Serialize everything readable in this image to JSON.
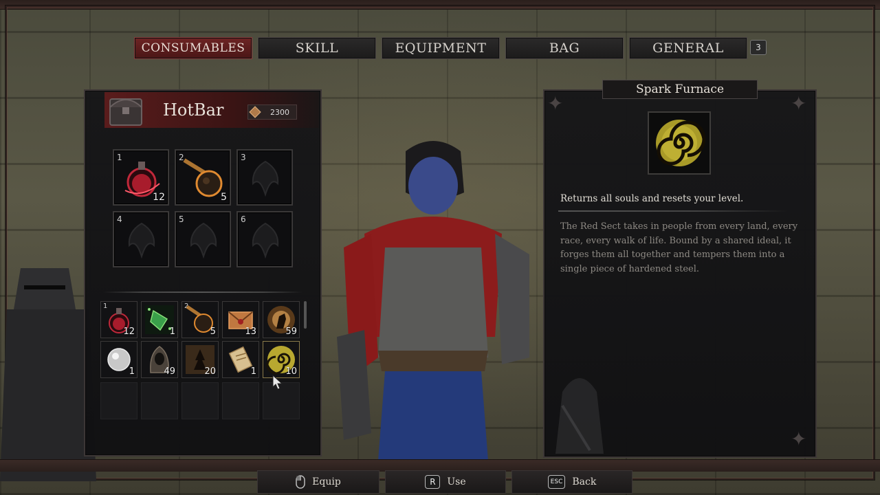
{
  "tabs": [
    {
      "label": "CONSUMABLES",
      "active": true
    },
    {
      "label": "SKILL",
      "active": false
    },
    {
      "label": "EQUIPMENT",
      "active": false
    },
    {
      "label": "BAG",
      "active": false
    },
    {
      "label": "GENERAL",
      "active": false
    }
  ],
  "tab_badge": "3",
  "hotbar": {
    "title": "HotBar",
    "currency": "2300",
    "slots": [
      {
        "num": "1",
        "count": "12",
        "icon": "red-potion-icon"
      },
      {
        "num": "2",
        "count": "5",
        "icon": "meteor-stone-icon"
      },
      {
        "num": "3",
        "count": "",
        "icon": "empty-slot-emblem-icon"
      },
      {
        "num": "4",
        "count": "",
        "icon": "empty-slot-emblem-icon"
      },
      {
        "num": "5",
        "count": "",
        "icon": "empty-slot-emblem-icon"
      },
      {
        "num": "6",
        "count": "",
        "icon": "empty-slot-emblem-icon"
      }
    ]
  },
  "inventory": [
    {
      "num": "1",
      "count": "12",
      "icon": "red-potion-icon"
    },
    {
      "num": "",
      "count": "1",
      "icon": "green-crystal-icon"
    },
    {
      "num": "2",
      "count": "5",
      "icon": "meteor-stone-icon"
    },
    {
      "num": "",
      "count": "13",
      "icon": "envelope-letter-icon"
    },
    {
      "num": "",
      "count": "59",
      "icon": "strength-fist-icon"
    },
    {
      "num": "",
      "count": "1",
      "icon": "silver-orb-icon"
    },
    {
      "num": "",
      "count": "49",
      "icon": "hooded-figure-icon"
    },
    {
      "num": "",
      "count": "20",
      "icon": "dark-tree-icon"
    },
    {
      "num": "",
      "count": "1",
      "icon": "scroll-icon"
    },
    {
      "num": "",
      "count": "10",
      "icon": "spark-furnace-spiral-icon"
    }
  ],
  "item": {
    "name": "Spark Furnace",
    "icon": "spark-furnace-spiral-icon",
    "effect": "Returns all souls and resets your level.",
    "lore": "The Red Sect takes in people from every land, every race, every walk of life. Bound by a shared ideal, it forges them all together and tempers them into a single piece of hardened steel."
  },
  "prompts": [
    {
      "key": "mouse-icon",
      "label": "Equip"
    },
    {
      "key": "R",
      "label": "Use"
    },
    {
      "key": "ESC",
      "label": "Back"
    }
  ],
  "colors": {
    "active_tab": "#6d2424",
    "panel_bg": "#161618",
    "hotbar_header": "#5a1c1c",
    "lore_text": "#8e8a84"
  }
}
